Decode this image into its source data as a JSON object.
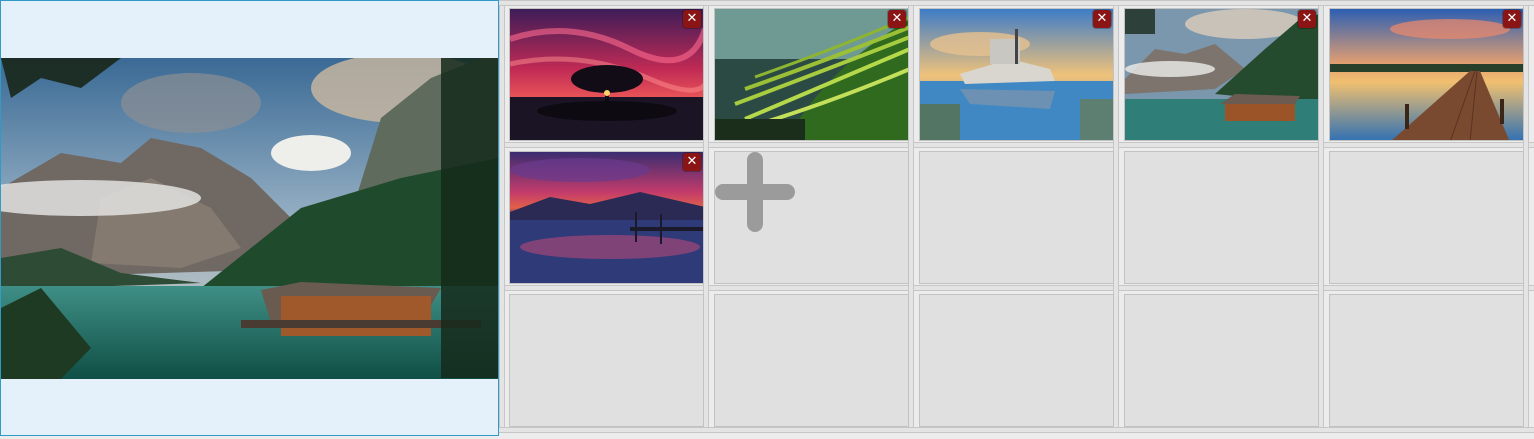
{
  "gallery": {
    "preview": {
      "description_icon": "landscape-preview-image"
    },
    "thumbnails": [
      {
        "icon": "sunset-tree-image",
        "close_label": "✕",
        "remove_icon": "close-icon"
      },
      {
        "icon": "rice-terraces-image",
        "close_label": "✕",
        "remove_icon": "close-icon"
      },
      {
        "icon": "shipwreck-image",
        "close_label": "✕",
        "remove_icon": "close-icon"
      },
      {
        "icon": "mountain-lake-cabin-image",
        "close_label": "✕",
        "remove_icon": "close-icon"
      },
      {
        "icon": "pier-sunset-image",
        "close_label": "✕",
        "remove_icon": "close-icon"
      },
      {
        "icon": "lake-reflection-image",
        "close_label": "✕",
        "remove_icon": "close-icon"
      }
    ],
    "add_button": {
      "icon": "plus-icon"
    },
    "empty_slots": 8,
    "colors": {
      "preview_bg": "#e4f1fb",
      "preview_border": "#2f9bc6",
      "close_button": "#8b1414",
      "slot_bg": "#e0e0e0",
      "plus": "#9b9b9b"
    }
  }
}
